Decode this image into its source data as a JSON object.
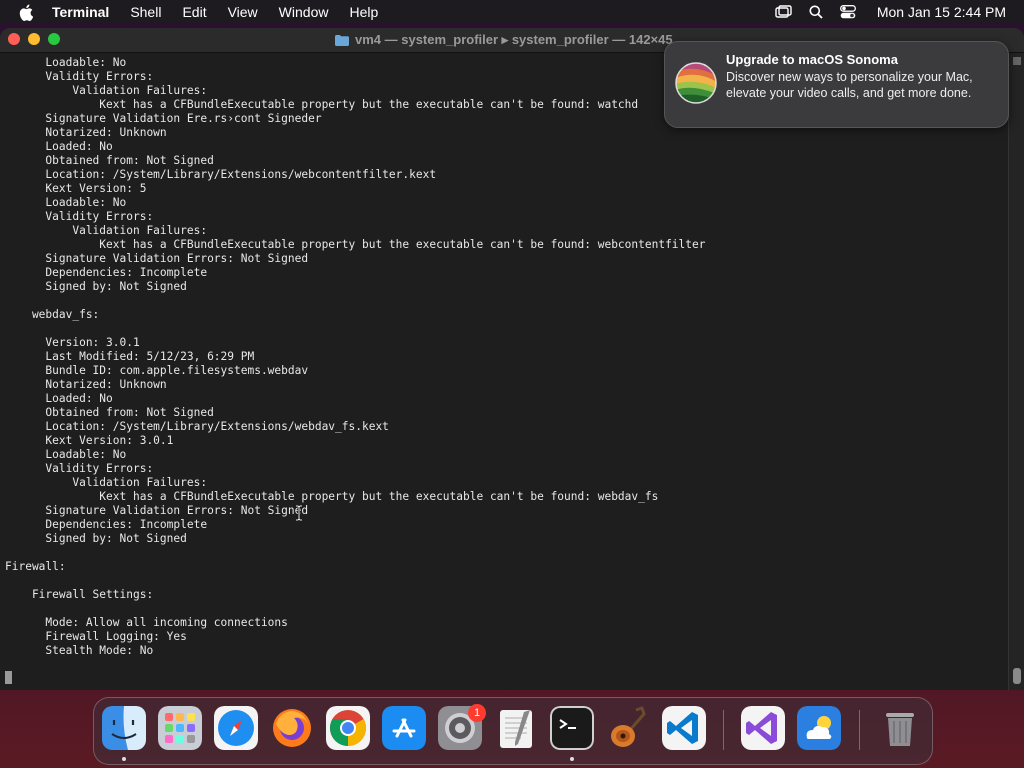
{
  "menubar": {
    "app_name": "Terminal",
    "menus": [
      "Shell",
      "Edit",
      "View",
      "Window",
      "Help"
    ],
    "clock": "Mon Jan 15  2:44 PM"
  },
  "window": {
    "title": "vm4 — system_profiler ▸ system_profiler — 142×45"
  },
  "terminal": {
    "lines": [
      "      Loadable: No",
      "      Validity Errors:",
      "          Validation Failures:",
      "              Kext has a CFBundleExecutable property but the executable can't be found: watchd",
      "      Signature Validation Ere.rs›cont Signeder",
      "      Notarized: Unknown",
      "      Loaded: No",
      "      Obtained from: Not Signed",
      "      Location: /System/Library/Extensions/webcontentfilter.kext",
      "      Kext Version: 5",
      "      Loadable: No",
      "      Validity Errors:",
      "          Validation Failures:",
      "              Kext has a CFBundleExecutable property but the executable can't be found: webcontentfilter",
      "      Signature Validation Errors: Not Signed",
      "      Dependencies: Incomplete",
      "      Signed by: Not Signed",
      "",
      "    webdav_fs:",
      "",
      "      Version: 3.0.1",
      "      Last Modified: 5/12/23, 6:29 PM",
      "      Bundle ID: com.apple.filesystems.webdav",
      "      Notarized: Unknown",
      "      Loaded: No",
      "      Obtained from: Not Signed",
      "      Location: /System/Library/Extensions/webdav_fs.kext",
      "      Kext Version: 3.0.1",
      "      Loadable: No",
      "      Validity Errors:",
      "          Validation Failures:",
      "              Kext has a CFBundleExecutable property but the executable can't be found: webdav_fs",
      "      Signature Validation Errors: Not Signed",
      "      Dependencies: Incomplete",
      "      Signed by: Not Signed",
      "",
      "Firewall:",
      "",
      "    Firewall Settings:",
      "",
      "      Mode: Allow all incoming connections",
      "      Firewall Logging: Yes",
      "      Stealth Mode: No"
    ]
  },
  "notification": {
    "title": "Upgrade to macOS Sonoma",
    "body": "Discover new ways to personalize your Mac, elevate your video calls, and get more done."
  },
  "dock": {
    "settings_badge": "1",
    "apps": [
      "finder-icon",
      "launchpad-icon",
      "safari-icon",
      "firefox-icon",
      "chrome-icon",
      "app-store-icon",
      "system-settings-icon",
      "textedit-icon",
      "terminal-icon",
      "garageband-icon",
      "vscode-icon",
      "visual-studio-icon",
      "weather-icon",
      "trash-icon"
    ]
  }
}
